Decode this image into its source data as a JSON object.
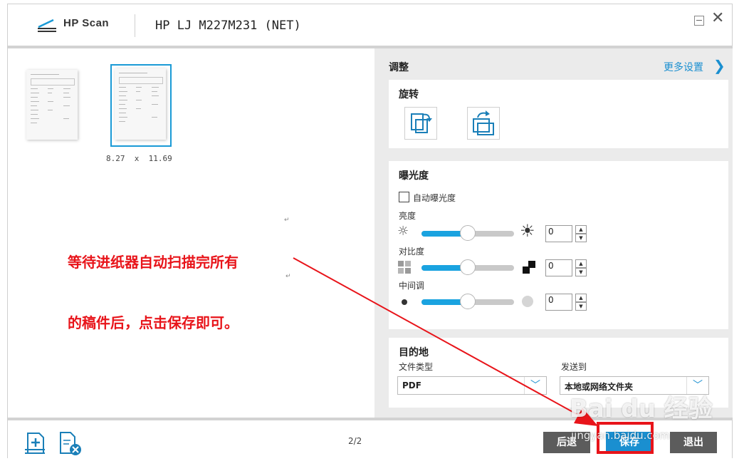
{
  "title_bar": {
    "app_name": "HP Scan",
    "device_name": "HP LJ M227M231 (NET)"
  },
  "preview": {
    "thumbnails": [
      {
        "selected": false
      },
      {
        "selected": true,
        "dimensions": "8.27  x  11.69"
      }
    ]
  },
  "annotation": {
    "line1": "等待进纸器自动扫描完所有",
    "line2": "的稿件后，点击保存即可。",
    "return_mark": "↵",
    "color": "#e8141a"
  },
  "panel": {
    "title": "调整",
    "more_settings": "更多设置",
    "rotate": {
      "title": "旋转",
      "buttons": [
        "rotate-left-icon",
        "rotate-right-icon"
      ]
    },
    "exposure": {
      "title": "曝光度",
      "auto_label": "自动曝光度",
      "auto_checked": false,
      "brightness": {
        "label": "亮度",
        "value": "0",
        "level": 0.5
      },
      "contrast": {
        "label": "对比度",
        "value": "0",
        "level": 0.5
      },
      "midtone": {
        "label": "中间调",
        "value": "0",
        "level": 0.5
      }
    },
    "destination": {
      "title": "目的地",
      "file_type_label": "文件类型",
      "file_type_value": "PDF",
      "send_to_label": "发送到",
      "send_to_value": "本地或网络文件夹"
    }
  },
  "bottom_bar": {
    "page_count": "2/2",
    "back_label": "后退",
    "save_label": "保存",
    "exit_label": "退出"
  },
  "watermark": {
    "brand": "Bai du 经验",
    "url": "jingyan.baidu.com"
  },
  "accent_color": "#1a9ad6"
}
